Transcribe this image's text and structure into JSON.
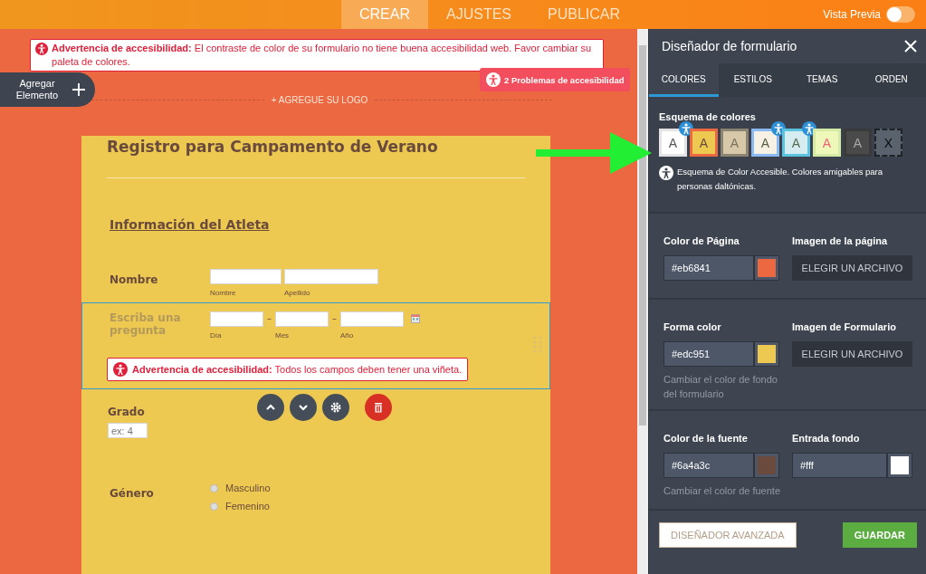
{
  "top_bar": {
    "tabs": [
      {
        "label": "CREAR",
        "selected": true
      },
      {
        "label": "AJUSTES",
        "selected": false
      },
      {
        "label": "PUBLICAR",
        "selected": false
      }
    ],
    "preview": {
      "label": "Vista Previa",
      "on": false
    }
  },
  "canvas": {
    "warning": {
      "title": "Advertencia de accesibilidad:",
      "text": "El contraste de color de su formulario no tiene buena accesibilidad web. Favor cambiar su paleta de colores."
    },
    "add_element": "Agregar Elemento",
    "issues_badge": "2 Problemas de accesibilidad",
    "logo": "+ AGREGUE SU LOGO"
  },
  "form": {
    "title": "Registro para Campamento de Verano",
    "fields": [
      {
        "kind": "heading",
        "label": "Información del Atleta",
        "selected": false
      },
      {
        "kind": "name",
        "label": "Nombre",
        "muted": false,
        "selected": false,
        "sublabels": [
          "Nombre",
          "Apellido"
        ]
      },
      {
        "kind": "date",
        "label": "Escriba una pregunta",
        "muted": true,
        "selected": true,
        "sublabels": [
          "Día",
          "Mes",
          "Año"
        ],
        "separators": [
          "–",
          "–"
        ],
        "warning": {
          "title": "Advertencia de accesibilidad:",
          "text": "Todos los campos deben tener una viñeta."
        }
      },
      {
        "kind": "number",
        "label": "Grado",
        "muted": false,
        "selected": false,
        "placeholder": "ex: 4"
      },
      {
        "kind": "radio",
        "label": "Género",
        "muted": false,
        "selected": false,
        "options": [
          {
            "label": "Masculino",
            "checked": false
          },
          {
            "label": "Femenino",
            "checked": false
          }
        ]
      }
    ]
  },
  "designer": {
    "title": "Diseñador de formulario",
    "tabs": [
      {
        "label": "COLORES",
        "selected": true
      },
      {
        "label": "ESTILOS",
        "selected": false
      },
      {
        "label": "TEMAS",
        "selected": false
      },
      {
        "label": "ORDEN",
        "selected": false
      }
    ],
    "scheme": {
      "title": "Esquema de colores",
      "swatches": [
        {
          "kind": "swatch",
          "color": "#ffffff",
          "border": {
            "color": "#e4e4e4"
          },
          "letter": {
            "text": "A",
            "color": "#555555"
          },
          "accessible": true
        },
        {
          "kind": "swatch",
          "color": "#edc951",
          "border": {
            "color": "#eb6841"
          },
          "letter": {
            "text": "A",
            "color": "#6a4a3c"
          },
          "accessible": false
        },
        {
          "kind": "swatch",
          "color": "#d6c8a8",
          "border": {
            "color": "#8a8470"
          },
          "letter": {
            "text": "A",
            "color": "#7a7060"
          },
          "accessible": false
        },
        {
          "kind": "swatch",
          "color": "#f6f1e4",
          "border": {
            "color": "#8ab8f0"
          },
          "letter": {
            "text": "A",
            "color": "#556040"
          },
          "accessible": true
        },
        {
          "kind": "swatch",
          "color": "#d5edf0",
          "border": {
            "color": "#5bc3de"
          },
          "letter": {
            "text": "A",
            "color": "#556a50"
          },
          "accessible": true
        },
        {
          "kind": "swatch",
          "color": "#eef8b8",
          "border": {
            "color": "#d5eaa6"
          },
          "letter": {
            "text": "A",
            "color": "#f0607a"
          },
          "accessible": false
        },
        {
          "kind": "swatch",
          "color": "#4a4a4a",
          "border": {
            "color": "#3a3a3a"
          },
          "letter": {
            "text": "A",
            "color": "#a8a8a8"
          },
          "accessible": false
        },
        {
          "kind": "none",
          "letter": {
            "text": "X"
          }
        }
      ],
      "note": "Esquema de Color Accesible. Colores amigables para personas daltónicas."
    },
    "settings": [
      {
        "items": [
          {
            "kind": "color",
            "label": "Color de Página",
            "value": "#eb6841",
            "color": "#eb6841"
          },
          {
            "kind": "file",
            "label": "Imagen de la página",
            "button": "ELEGIR UN ARCHIVO"
          }
        ]
      },
      {
        "items": [
          {
            "kind": "color",
            "label": "Forma color",
            "value": "#edc951",
            "color": "#edc951"
          },
          {
            "kind": "file",
            "label": "Imagen de Formulario",
            "button": "ELEGIR UN ARCHIVO"
          }
        ],
        "hint": "Cambiar el color de fondo del formulario"
      },
      {
        "items": [
          {
            "kind": "color",
            "label": "Color de la fuente",
            "value": "#6a4a3c",
            "color": "#6a4a3c"
          },
          {
            "kind": "color",
            "label": "Entrada fondo",
            "value": "#fff",
            "color": "#ffffff"
          }
        ],
        "hint": "Cambiar el color de fuente"
      }
    ],
    "buttons": [
      {
        "kind": "secondary",
        "label": "DISEÑADOR AVANZADA"
      },
      {
        "kind": "primary",
        "label": "GUARDAR"
      }
    ]
  }
}
